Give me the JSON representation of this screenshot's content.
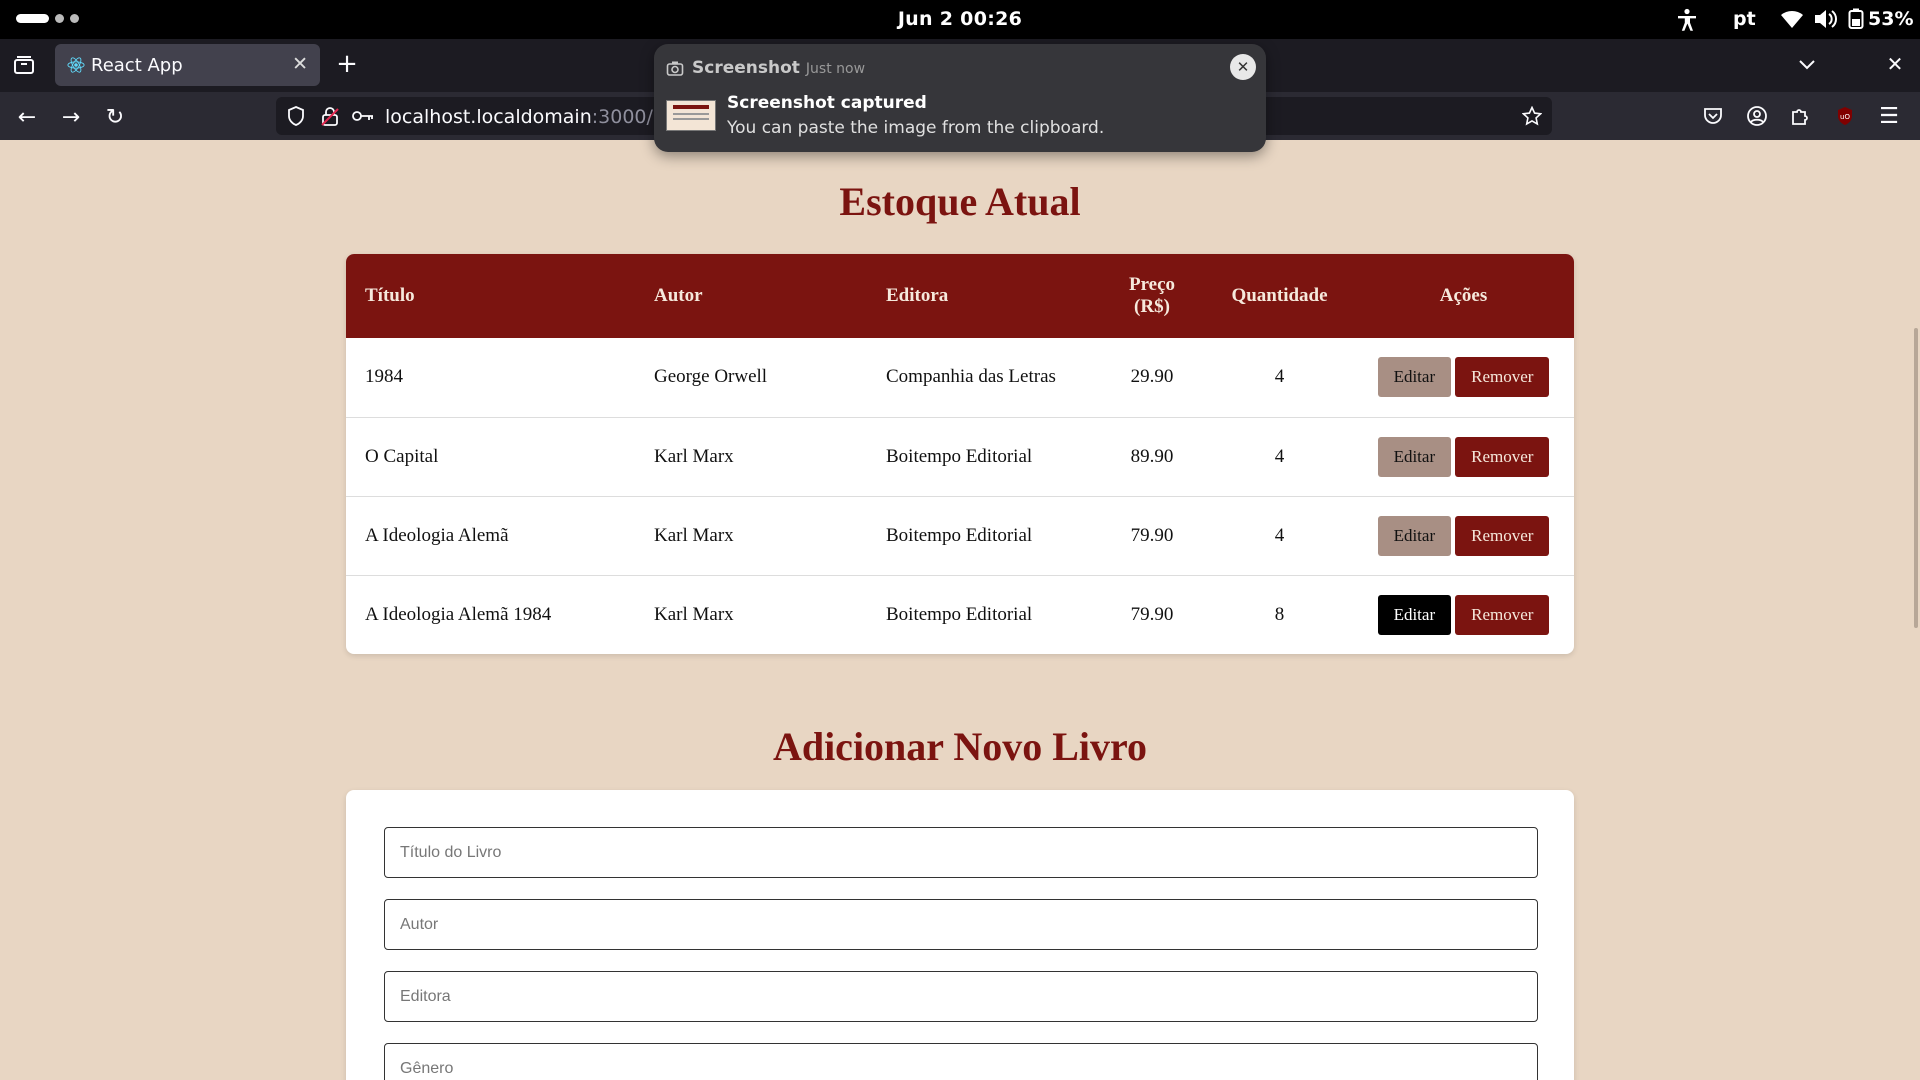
{
  "system": {
    "clock": "Jun 2  00:26",
    "language": "pt",
    "battery": "53%"
  },
  "browser": {
    "tab_title": "React App",
    "url_host": "localhost.localdomain",
    "url_rest": ":3000/adm"
  },
  "notification": {
    "app": "Screenshot",
    "when": "Just now",
    "title": "Screenshot captured",
    "body": "You can paste the image from the clipboard."
  },
  "inventory": {
    "heading": "Estoque Atual",
    "columns": [
      "Título",
      "Autor",
      "Editora",
      "Preço (R$)",
      "Quantidade",
      "Ações"
    ],
    "edit_label": "Editar",
    "remove_label": "Remover",
    "rows": [
      {
        "titulo": "1984",
        "autor": "George Orwell",
        "editora": "Companhia das Letras",
        "preco": "29.90",
        "quantidade": "4"
      },
      {
        "titulo": "O Capital",
        "autor": "Karl Marx",
        "editora": "Boitempo Editorial",
        "preco": "89.90",
        "quantidade": "4"
      },
      {
        "titulo": "A Ideologia Alemã",
        "autor": "Karl Marx",
        "editora": "Boitempo Editorial",
        "preco": "79.90",
        "quantidade": "4"
      },
      {
        "titulo": "A Ideologia Alemã 1984",
        "autor": "Karl Marx",
        "editora": "Boitempo Editorial",
        "preco": "79.90",
        "quantidade": "8"
      }
    ]
  },
  "add_book": {
    "heading": "Adicionar Novo Livro",
    "fields": {
      "titulo": "Título do Livro",
      "autor": "Autor",
      "editora": "Editora",
      "genero": "Gênero"
    }
  }
}
